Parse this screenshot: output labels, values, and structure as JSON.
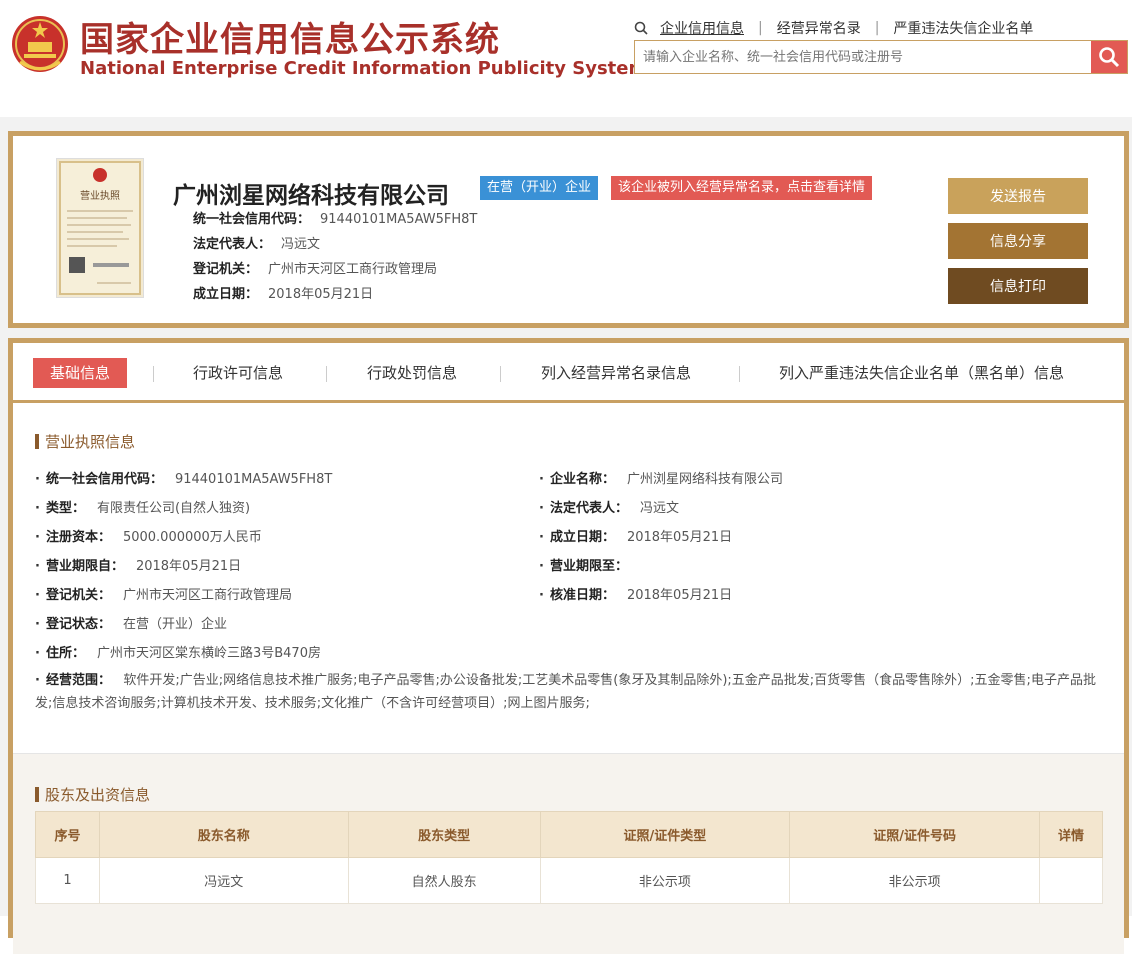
{
  "header": {
    "title_cn": "国家企业信用信息公示系统",
    "title_en": "National Enterprise Credit Information Publicity System",
    "nav_links": [
      "企业信用信息",
      "经营异常名录",
      "严重违法失信企业名单"
    ],
    "search_placeholder": "请输入企业名称、统一社会信用代码或注册号"
  },
  "company": {
    "license_image_label": "营业执照",
    "name": "广州浏星网络科技有限公司",
    "status_tag": "在营（开业）企业",
    "warning_tag": "该企业被列入经营异常名录，点击查看详情",
    "fields": [
      {
        "label": "统一社会信用代码：",
        "value": "91440101MA5AW5FH8T"
      },
      {
        "label": "法定代表人：",
        "value": "冯远文"
      },
      {
        "label": "登记机关：",
        "value": "广州市天河区工商行政管理局"
      },
      {
        "label": "成立日期：",
        "value": "2018年05月21日"
      }
    ],
    "buttons": {
      "send": "发送报告",
      "share": "信息分享",
      "print": "信息打印"
    }
  },
  "tabs": [
    "基础信息",
    "行政许可信息",
    "行政处罚信息",
    "列入经营异常名录信息",
    "列入严重违法失信企业名单（黑名单）信息"
  ],
  "license_section": {
    "title": "营业执照信息",
    "left": [
      {
        "label": "统一社会信用代码：",
        "value": "91440101MA5AW5FH8T"
      },
      {
        "label": "类型：",
        "value": "有限责任公司(自然人独资)"
      },
      {
        "label": "注册资本：",
        "value": "5000.000000万人民币"
      },
      {
        "label": "营业期限自：",
        "value": "2018年05月21日"
      },
      {
        "label": "登记机关：",
        "value": "广州市天河区工商行政管理局"
      },
      {
        "label": "登记状态：",
        "value": "在营（开业）企业"
      },
      {
        "label": "住所：",
        "value": "广州市天河区棠东横岭三路3号B470房"
      }
    ],
    "right": [
      {
        "label": "企业名称：",
        "value": "广州浏星网络科技有限公司"
      },
      {
        "label": "法定代表人：",
        "value": "冯远文"
      },
      {
        "label": "成立日期：",
        "value": "2018年05月21日"
      },
      {
        "label": "营业期限至：",
        "value": ""
      },
      {
        "label": "核准日期：",
        "value": "2018年05月21日"
      }
    ],
    "scope_label": "经营范围：",
    "scope_value": "软件开发;广告业;网络信息技术推广服务;电子产品零售;办公设备批发;工艺美术品零售(象牙及其制品除外);五金产品批发;百货零售（食品零售除外）;五金零售;电子产品批发;信息技术咨询服务;计算机技术开发、技术服务;文化推广（不含许可经营项目）;网上图片服务;"
  },
  "shareholders": {
    "title": "股东及出资信息",
    "columns": [
      "序号",
      "股东名称",
      "股东类型",
      "证照/证件类型",
      "证照/证件号码",
      "详情"
    ],
    "rows": [
      [
        "1",
        "冯远文",
        "自然人股东",
        "非公示项",
        "非公示项",
        ""
      ]
    ]
  },
  "colors": {
    "accent_gold": "#c8a063",
    "brand_red": "#a8302a",
    "tag_blue": "#3a91d6",
    "tag_red": "#e25a54"
  }
}
